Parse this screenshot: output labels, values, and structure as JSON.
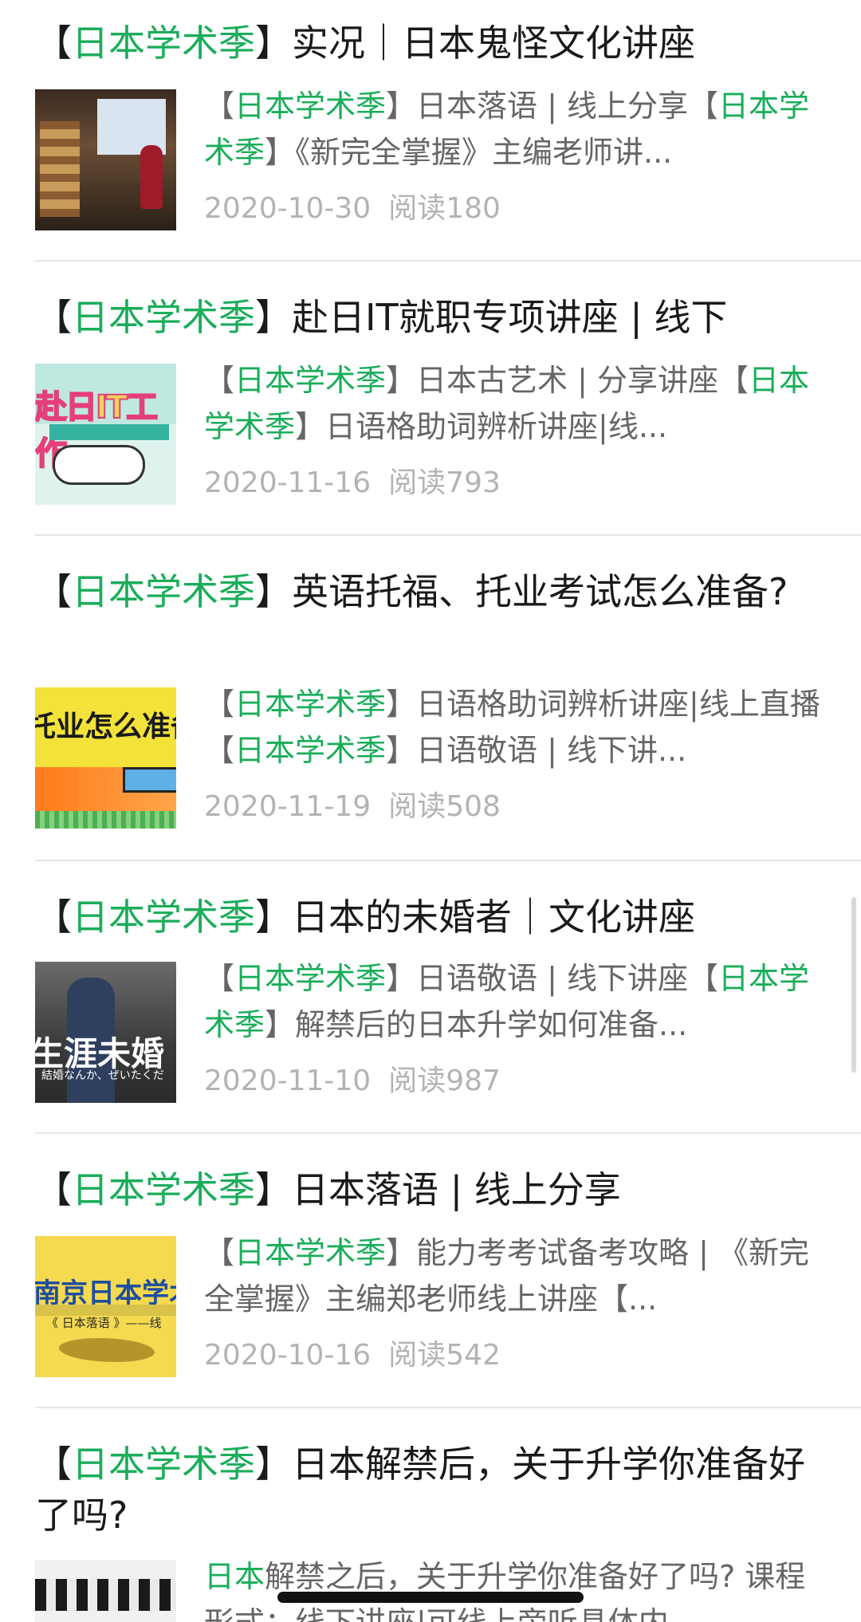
{
  "articles": [
    {
      "title_highlight": "日本学术季",
      "title_rest": "实况｜日本鬼怪文化讲座",
      "snippet": [
        {
          "text": "【",
          "hl": false
        },
        {
          "text": "日本学术季",
          "hl": true
        },
        {
          "text": "】日本落语 | 线上分享【",
          "hl": false
        },
        {
          "text": "日本学术季",
          "hl": true
        },
        {
          "text": "】《新完全掌握》主编老师讲...",
          "hl": false
        }
      ],
      "date": "2020-10-30",
      "reads": "阅读180",
      "thumb_icon": "lecture-photo-thumbnail"
    },
    {
      "title_highlight": "日本学术季",
      "title_rest": "赴日IT就职专项讲座 | 线下",
      "snippet": [
        {
          "text": "【",
          "hl": false
        },
        {
          "text": "日本学术季",
          "hl": true
        },
        {
          "text": "】日本古艺术 | 分享讲座【",
          "hl": false
        },
        {
          "text": "日本学术季",
          "hl": true
        },
        {
          "text": "】日语格助词辨析讲座|线...",
          "hl": false
        }
      ],
      "date": "2020-11-16",
      "reads": "阅读793",
      "thumb_icon": "it-poster-thumbnail"
    },
    {
      "title_highlight": "日本学术季",
      "title_rest": "英语托福、托业考试怎么准备?",
      "snippet": [
        {
          "text": "【",
          "hl": false
        },
        {
          "text": "日本学术季",
          "hl": true
        },
        {
          "text": "】日语格助词辨析讲座|线上直播【",
          "hl": false
        },
        {
          "text": "日本学术季",
          "hl": true
        },
        {
          "text": "】日语敬语 | 线下讲...",
          "hl": false
        }
      ],
      "date": "2020-11-19",
      "reads": "阅读508",
      "thumb_icon": "toefl-poster-thumbnail"
    },
    {
      "title_highlight": "日本学术季",
      "title_rest": "日本的未婚者｜文化讲座",
      "snippet": [
        {
          "text": "【",
          "hl": false
        },
        {
          "text": "日本学术季",
          "hl": true
        },
        {
          "text": "】日语敬语 | 线下讲座【",
          "hl": false
        },
        {
          "text": "日本学术季",
          "hl": true
        },
        {
          "text": "】解禁后的日本升学如何准备...",
          "hl": false
        }
      ],
      "date": "2020-11-10",
      "reads": "阅读987",
      "thumb_icon": "unmarried-poster-thumbnail"
    },
    {
      "title_highlight": "日本学术季",
      "title_rest": "日本落语 | 线上分享",
      "snippet": [
        {
          "text": "【",
          "hl": false
        },
        {
          "text": "日本学术季",
          "hl": true
        },
        {
          "text": "】能力考考试备考攻略 | 《新完全掌握》主编郑老师线上讲座【...",
          "hl": false
        }
      ],
      "date": "2020-10-16",
      "reads": "阅读542",
      "thumb_icon": "rakugo-poster-thumbnail"
    },
    {
      "title_highlight": "日本学术季",
      "title_rest": "日本解禁后，关于升学你准备好了吗?",
      "snippet": [
        {
          "text": "日本",
          "hl": true
        },
        {
          "text": "解禁之后，关于升学你准备好了吗? 课程形式：线下讲座|可线上旁听具体内",
          "hl": false
        }
      ],
      "date": "",
      "reads": "",
      "thumb_icon": "audience-photo-thumbnail"
    }
  ],
  "thumb_texts": {
    "it": "赴日IT工作",
    "toefl": "托业怎么准备",
    "unmarried": "生涯未婚",
    "unmarried_sub": "結婚なんか、ぜいたくだ",
    "rakugo": "南京日本学术",
    "rakugo_sub": "《 日本落语 》——线"
  },
  "colors": {
    "highlight": "#1aad5a",
    "title": "#1a1a1a",
    "snippet": "#666666",
    "meta": "#b3b3b3",
    "divider": "#e6e6e6"
  }
}
